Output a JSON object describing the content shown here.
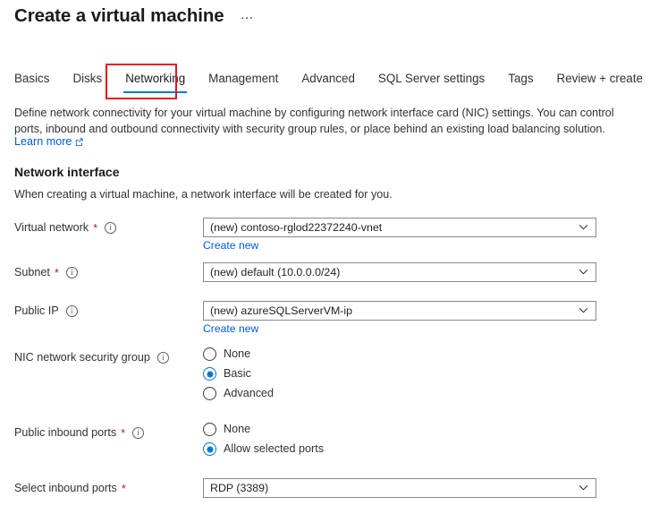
{
  "header": {
    "title": "Create a virtual machine",
    "more_menu": "…"
  },
  "tabs": [
    {
      "label": "Basics",
      "selected": false
    },
    {
      "label": "Disks",
      "selected": false
    },
    {
      "label": "Networking",
      "selected": true
    },
    {
      "label": "Management",
      "selected": false
    },
    {
      "label": "Advanced",
      "selected": false
    },
    {
      "label": "SQL Server settings",
      "selected": false
    },
    {
      "label": "Tags",
      "selected": false
    },
    {
      "label": "Review + create",
      "selected": false
    }
  ],
  "intro": {
    "description": "Define network connectivity for your virtual machine by configuring network interface card (NIC) settings. You can control ports, inbound and outbound connectivity with security group rules, or place behind an existing load balancing solution.",
    "learn_more": "Learn more"
  },
  "section": {
    "title": "Network interface",
    "subtitle": "When creating a virtual machine, a network interface will be created for you."
  },
  "fields": {
    "virtual_network": {
      "label": "Virtual network",
      "required": "*",
      "value": "(new) contoso-rglod22372240-vnet",
      "create_new": "Create new"
    },
    "subnet": {
      "label": "Subnet",
      "required": "*",
      "value": "(new) default (10.0.0.0/24)"
    },
    "public_ip": {
      "label": "Public IP",
      "value": "(new) azureSQLServerVM-ip",
      "create_new": "Create new"
    },
    "nic_nsg": {
      "label": "NIC network security group",
      "options": [
        {
          "label": "None",
          "selected": false
        },
        {
          "label": "Basic",
          "selected": true
        },
        {
          "label": "Advanced",
          "selected": false
        }
      ]
    },
    "public_inbound_ports": {
      "label": "Public inbound ports",
      "required": "*",
      "options": [
        {
          "label": "None",
          "selected": false
        },
        {
          "label": "Allow selected ports",
          "selected": true
        }
      ]
    },
    "select_inbound_ports": {
      "label": "Select inbound ports",
      "required": "*",
      "value": "RDP (3389)"
    }
  },
  "colors": {
    "accent": "#0078d4",
    "link": "#015cda",
    "required": "#a4262c",
    "highlight": "#e81123"
  }
}
